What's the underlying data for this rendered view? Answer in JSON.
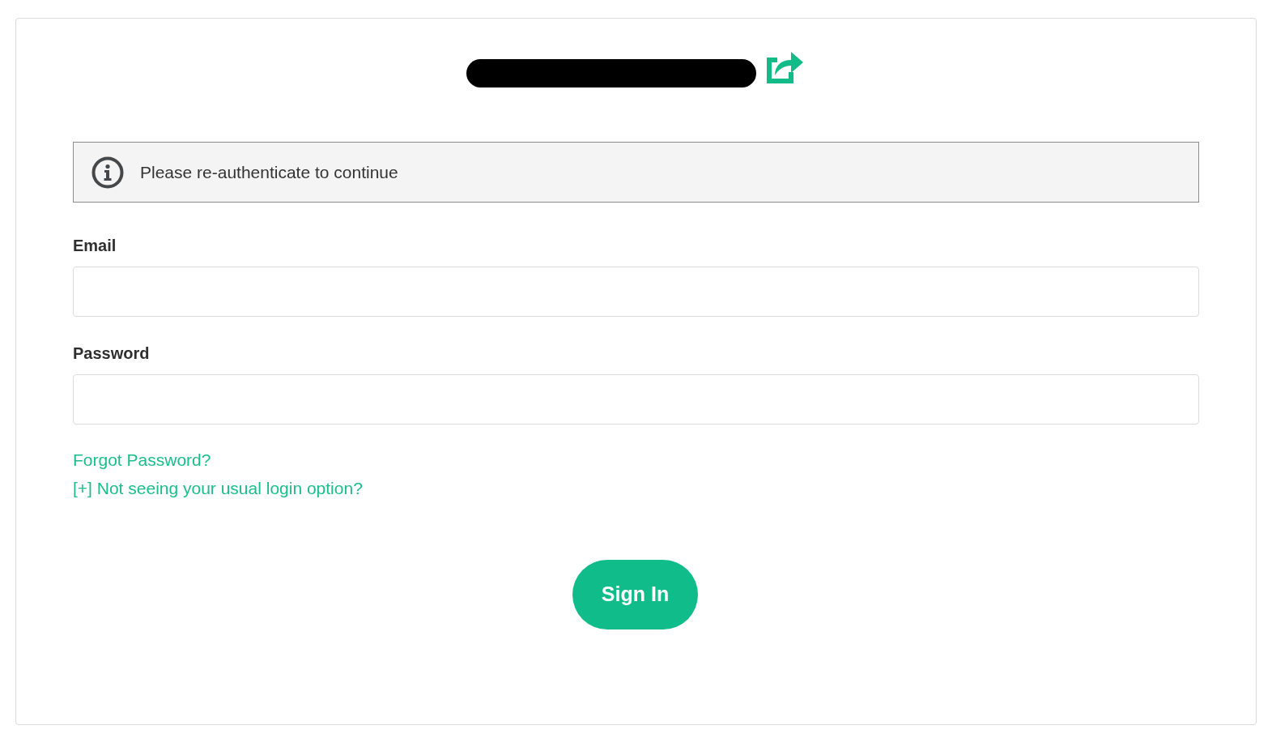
{
  "notice": {
    "text": "Please re-authenticate to continue"
  },
  "form": {
    "fields": [
      {
        "label": "Email"
      },
      {
        "label": "Password"
      }
    ],
    "links": [
      "Forgot Password?",
      "[+] Not seeing your usual login option?"
    ],
    "submit": "Sign In"
  }
}
